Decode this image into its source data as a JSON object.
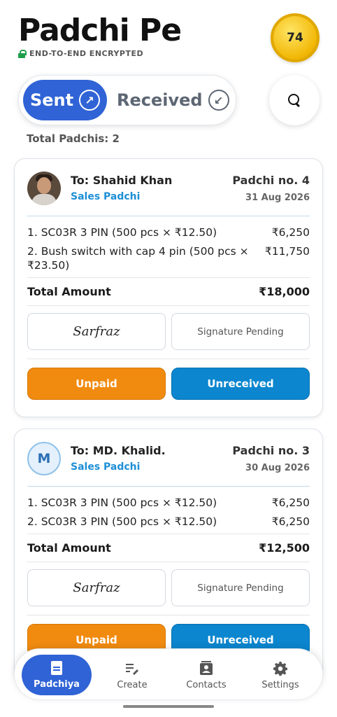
{
  "header": {
    "title": "Padchi Pe",
    "encryption_label": "END-TO-END ENCRYPTED",
    "coin_count": "74"
  },
  "toggle": {
    "sent_label": "Sent",
    "received_label": "Received",
    "sent_icon": "arrow-up-right-icon",
    "received_icon": "arrow-down-left-icon"
  },
  "summary": {
    "total_label": "Total Padchis: 2"
  },
  "padchis": [
    {
      "to": "To: Shahid Khan",
      "type": "Sales Padchi",
      "number": "Padchi no. 4",
      "date": "31 Aug 2026",
      "items": [
        {
          "desc": "1. SC03R 3 PIN (500 pcs × ₹12.50)",
          "amount": "₹6,250"
        },
        {
          "desc": "2. Bush switch with cap 4 pin (500 pcs × ₹23.50)",
          "amount": "₹11,750"
        }
      ],
      "total_label": "Total Amount",
      "total_value": "₹18,000",
      "signature": "Sarfraz",
      "signature_status": "Signature Pending",
      "payment_status": "Unpaid",
      "receipt_status": "Unreceived"
    },
    {
      "to": "To: MD. Khalid.",
      "type": "Sales Padchi",
      "avatar_initial": "M",
      "number": "Padchi no. 3",
      "date": "30 Aug 2026",
      "items": [
        {
          "desc": "1. SC03R 3 PIN (500 pcs × ₹12.50)",
          "amount": "₹6,250"
        },
        {
          "desc": "2. SC03R 3 PIN (500 pcs × ₹12.50)",
          "amount": "₹6,250"
        }
      ],
      "total_label": "Total Amount",
      "total_value": "₹12,500",
      "signature": "Sarfraz",
      "signature_status": "Signature Pending",
      "payment_status": "Unpaid",
      "receipt_status": "Unreceived"
    }
  ],
  "nav": {
    "items": [
      {
        "label": "Padchiya",
        "icon": "document-icon"
      },
      {
        "label": "Create",
        "icon": "edit-list-icon"
      },
      {
        "label": "Contacts",
        "icon": "contacts-icon"
      },
      {
        "label": "Settings",
        "icon": "gear-icon"
      }
    ]
  },
  "colors": {
    "primary": "#2f63d6",
    "unpaid": "#f18b10",
    "unreceived": "#0b86cf",
    "accent_text": "#1e8fd6",
    "coin": "#f2b705"
  }
}
